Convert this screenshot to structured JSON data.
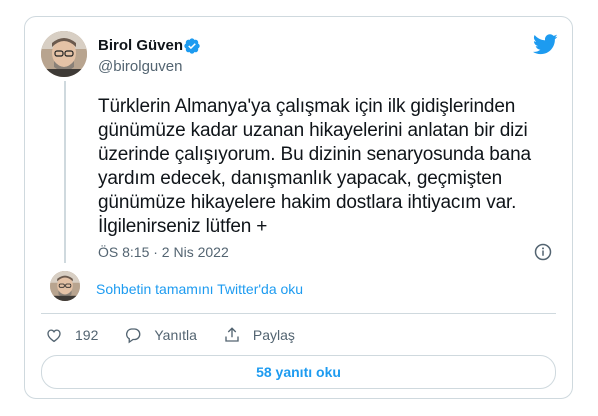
{
  "author": {
    "name": "Birol Güven",
    "handle": "@birolguven"
  },
  "tweet": {
    "text": "Türklerin Almanya'ya çalışmak için ilk gidişlerinden\ngünümüze  kadar uzanan hikayelerini anlatan bir dizi\nüzerinde çalışıyorum. Bu dizinin senaryosunda bana\nyardım edecek, danışmanlık yapacak, geçmişten\ngünümüze hikayelere hakim dostlara ihtiyacım var.\nİlgilenirseniz lütfen +",
    "timestamp": "ÖS 8:15 · 2 Nis 2022"
  },
  "thread": {
    "link_text": "Sohbetin tamamını Twitter'da oku"
  },
  "actions": {
    "like_count": "192",
    "reply_label": "Yanıtla",
    "share_label": "Paylaş"
  },
  "replies_button": "58 yanıtı oku",
  "colors": {
    "accent": "#1d9bf0",
    "secondary_text": "#536471",
    "border": "#cfd9de"
  },
  "icons": [
    "verified-badge-icon",
    "twitter-bird-icon",
    "info-icon",
    "heart-icon",
    "reply-icon",
    "share-icon"
  ]
}
